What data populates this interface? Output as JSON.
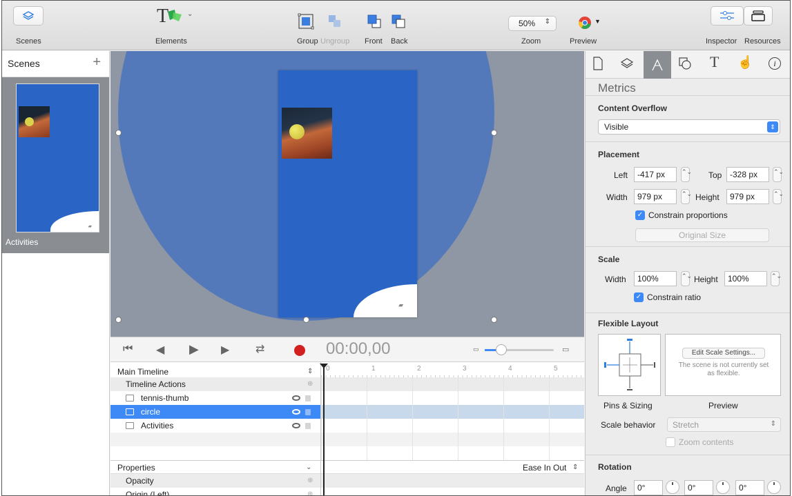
{
  "toolbar": {
    "scenes_label": "Scenes",
    "elements_label": "Elements",
    "group_label": "Group",
    "ungroup_label": "Ungroup",
    "front_label": "Front",
    "back_label": "Back",
    "zoom_value": "50%",
    "zoom_label": "Zoom",
    "preview_label": "Preview",
    "inspector_label": "Inspector",
    "resources_label": "Resources",
    "elements_logo": "T"
  },
  "scenes": {
    "title": "Scenes",
    "add_symbol": "+",
    "items": [
      {
        "name": "Activities"
      }
    ]
  },
  "timeline": {
    "time": "00:00,00",
    "main_timeline": "Main Timeline",
    "timeline_actions": "Timeline Actions",
    "ruler_ticks": [
      "0",
      "1",
      "2",
      "3",
      "4",
      "5"
    ],
    "layers": [
      {
        "name": "tennis-thumb",
        "selected": false
      },
      {
        "name": "circle",
        "selected": true
      },
      {
        "name": "Activities",
        "selected": false
      }
    ],
    "properties_label": "Properties",
    "easing": "Ease In Out",
    "property_rows": [
      "Opacity",
      "Origin (Left)"
    ]
  },
  "inspector": {
    "tabs": [
      "document-icon",
      "layers-icon",
      "metrics-icon",
      "identity-icon",
      "text-icon",
      "actions-icon",
      "info-icon"
    ],
    "header": "Metrics",
    "content_overflow": {
      "title": "Content Overflow",
      "value": "Visible"
    },
    "placement": {
      "title": "Placement",
      "left_label": "Left",
      "left_value": "-417 px",
      "top_label": "Top",
      "top_value": "-328 px",
      "width_label": "Width",
      "width_value": "979 px",
      "height_label": "Height",
      "height_value": "979 px",
      "constrain_label": "Constrain proportions",
      "original_size": "Original Size"
    },
    "scale": {
      "title": "Scale",
      "width_label": "Width",
      "width_value": "100%",
      "height_label": "Height",
      "height_value": "100%",
      "constrain_label": "Constrain ratio"
    },
    "flexible_layout": {
      "title": "Flexible Layout",
      "edit_button": "Edit Scale Settings...",
      "note": "The scene is not currently set as flexible.",
      "pins_label": "Pins & Sizing",
      "preview_label": "Preview",
      "scale_behavior_label": "Scale behavior",
      "scale_behavior_value": "Stretch",
      "zoom_contents": "Zoom contents"
    },
    "rotation": {
      "title": "Rotation",
      "angle_label": "Angle",
      "values": [
        "0°",
        "0°",
        "0°"
      ]
    }
  },
  "colors": {
    "accent": "#3d8af7",
    "scene_blue": "#2a65c5",
    "circle_blue": "#4a73c0",
    "selection": "#3d8af7",
    "record": "#d21f1f"
  }
}
